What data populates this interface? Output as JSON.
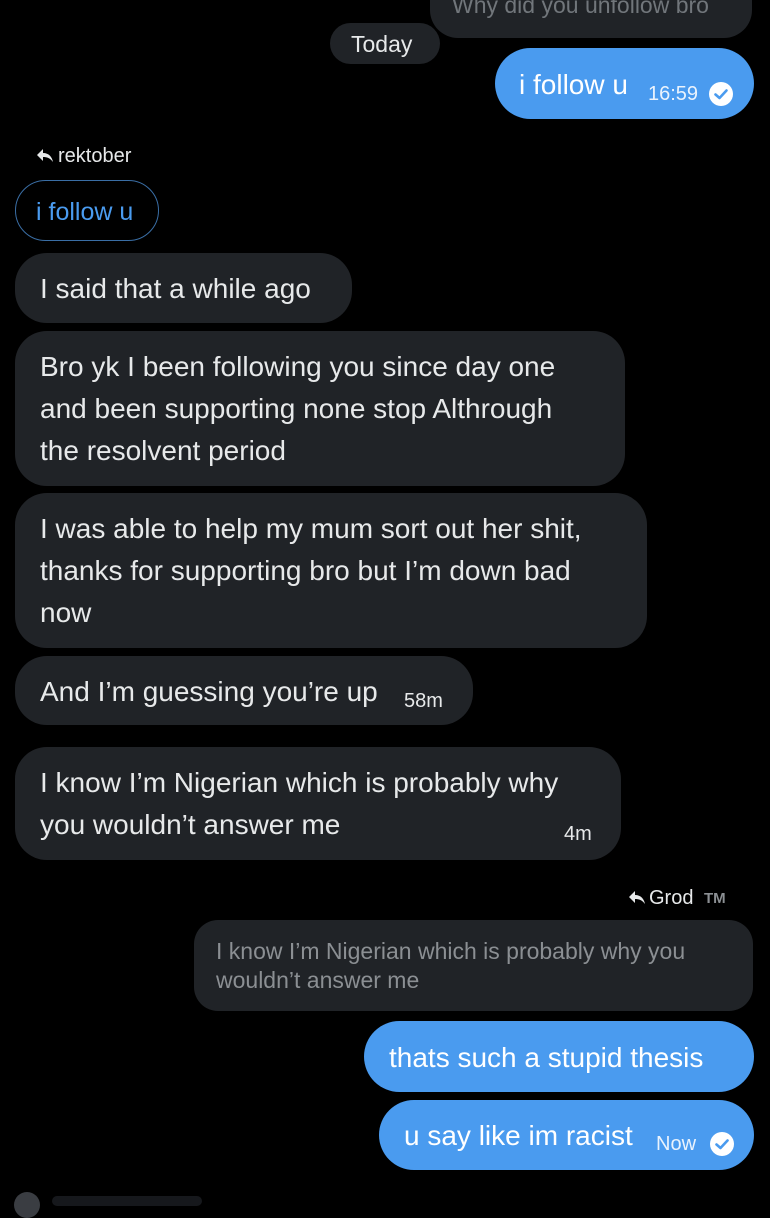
{
  "top_partial": {
    "text": "Why did you unfollow bro"
  },
  "date_divider": "Today",
  "msg1": {
    "text": "i follow u",
    "time": "16:59",
    "status_icon": "read-check-icon"
  },
  "reply1": {
    "author": "rektober",
    "quoted": "i follow u",
    "icon": "reply-arrow-icon"
  },
  "incoming": [
    {
      "lines": [
        "I said that a while ago"
      ]
    },
    {
      "lines": [
        "Bro yk I been following you since day one",
        "and been supporting none stop Althrough",
        "the resolvent period"
      ]
    },
    {
      "lines": [
        "I was able to help my mum sort out her shit,",
        "thanks for supporting bro but I’m down bad",
        "now"
      ]
    },
    {
      "lines": [
        "And I’m guessing you’re up"
      ],
      "time": "58m"
    },
    {
      "lines": [
        "I know I’m Nigerian which is probably why",
        "you wouldn’t answer me"
      ],
      "time": "4m"
    }
  ],
  "reply2": {
    "author": "Grod",
    "author_badge": "TM",
    "icon": "reply-arrow-icon",
    "quoted_lines": [
      "I know I’m Nigerian which is probably why you",
      "wouldn’t answer me"
    ]
  },
  "outgoing": [
    {
      "text": "thats such a stupid thesis"
    },
    {
      "text": "u say like im racist",
      "time": "Now",
      "status_icon": "read-check-icon"
    }
  ],
  "colors": {
    "background": "#000000",
    "incoming_bubble": "#202327",
    "outgoing_bubble": "#4a9bef",
    "accent": "#4a9bef"
  }
}
